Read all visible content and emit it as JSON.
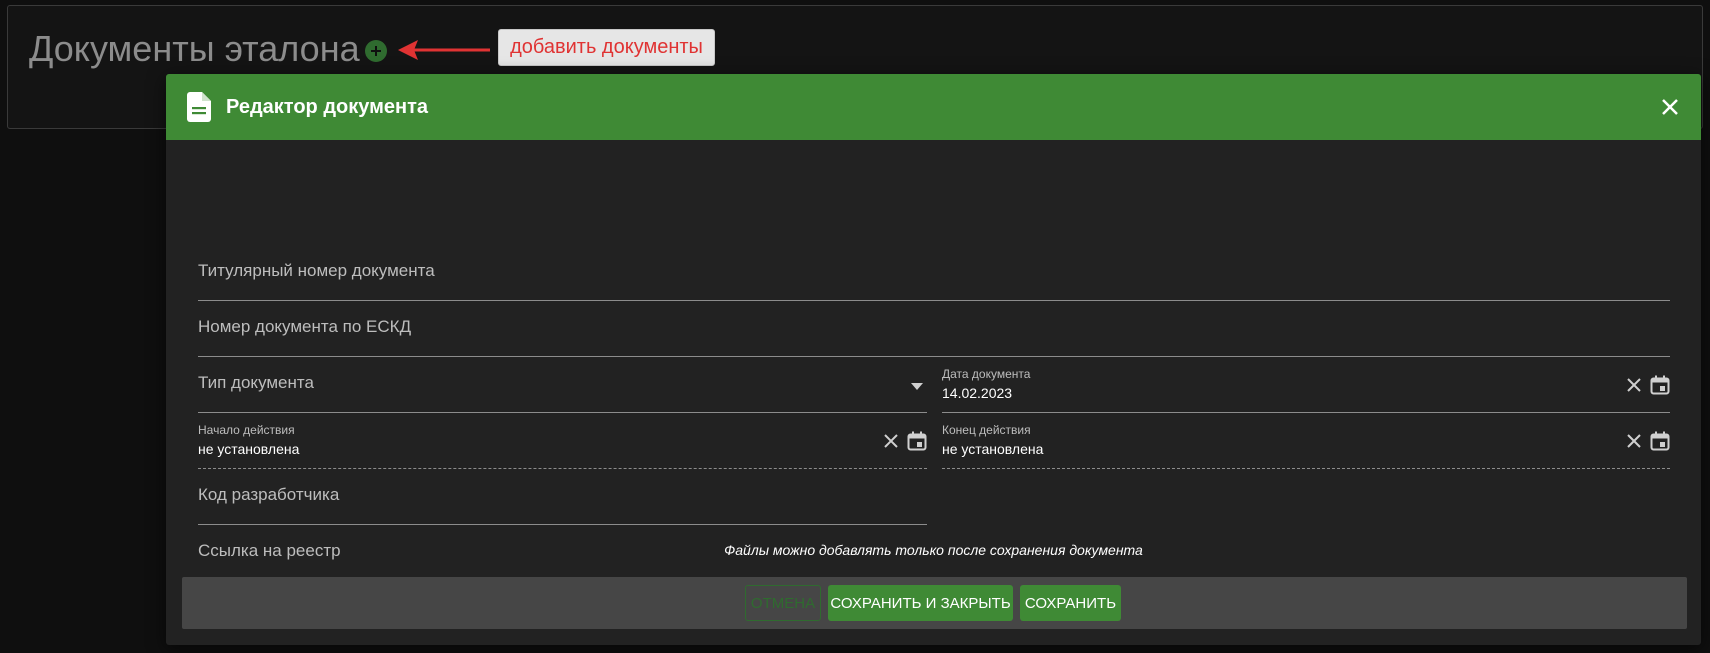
{
  "page": {
    "title": "Документы эталона"
  },
  "hint": {
    "label": "добавить документы",
    "arrow_color": "#e03333"
  },
  "dialog": {
    "title": "Редактор документа",
    "fields": {
      "title_number": {
        "placeholder": "Титулярный номер документа"
      },
      "eskd_number": {
        "placeholder": "Номер документа по ЕСКД"
      },
      "doc_type": {
        "placeholder": "Тип документа"
      },
      "doc_date": {
        "label": "Дата документа",
        "value": "14.02.2023"
      },
      "valid_from": {
        "label": "Начало действия",
        "value": "не установлена"
      },
      "valid_to": {
        "label": "Конец действия",
        "value": "не установлена"
      },
      "developer_code": {
        "placeholder": "Код разработчика"
      },
      "registry_link": {
        "placeholder": "Ссылка на реестр"
      }
    },
    "note": "Файлы можно добавлять только после сохранения документа",
    "buttons": {
      "cancel": "ОТМЕНА",
      "save_close": "СОХРАНИТЬ И ЗАКРЫТЬ",
      "save": "СОХРАНИТЬ"
    }
  },
  "colors": {
    "accent": "#3f8a35",
    "dialog_bg": "#222222",
    "page_bg": "#0f0f0f",
    "hint_text": "#e03333"
  },
  "icons": [
    "add-circle-icon",
    "document-icon",
    "close-icon",
    "clear-icon",
    "calendar-icon",
    "dropdown-arrow-icon"
  ]
}
